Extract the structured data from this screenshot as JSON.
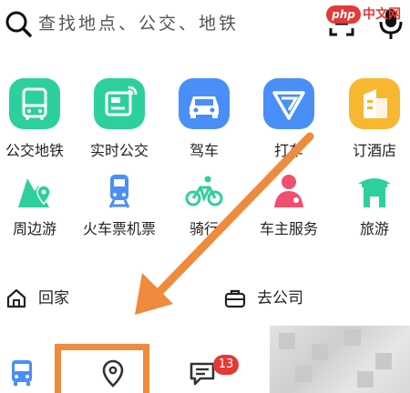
{
  "search": {
    "placeholder": "查找地点、公交、地铁"
  },
  "watermark": {
    "logo": "php",
    "text": "中文网"
  },
  "services_row1": [
    {
      "id": "transit",
      "label": "公交地铁",
      "icon": "bus-icon",
      "color": "#2ecf9e"
    },
    {
      "id": "realtime-bus",
      "label": "实时公交",
      "icon": "realtime-bus-icon",
      "color": "#2ecf9e"
    },
    {
      "id": "drive",
      "label": "驾车",
      "icon": "car-icon",
      "color": "#4a8ff7"
    },
    {
      "id": "taxi",
      "label": "打车",
      "icon": "taxi-icon",
      "color": "#4a8ff7"
    },
    {
      "id": "hotel",
      "label": "订酒店",
      "icon": "hotel-icon",
      "color": "#f7b731"
    }
  ],
  "services_row2": [
    {
      "id": "nearby-tour",
      "label": "周边游",
      "icon": "map-pin-icon",
      "color": "#2ecf9e"
    },
    {
      "id": "train-plane",
      "label": "火车票机票",
      "icon": "train-icon",
      "color": "#4a8ff7"
    },
    {
      "id": "cycling",
      "label": "骑行",
      "icon": "bicycle-icon",
      "color": "#2ecf9e"
    },
    {
      "id": "car-owner",
      "label": "车主服务",
      "icon": "person-icon",
      "color": "#f0506e"
    },
    {
      "id": "travel",
      "label": "旅游",
      "icon": "temple-icon",
      "color": "#2ecf9e"
    }
  ],
  "shortcuts": [
    {
      "id": "home",
      "label": "回家",
      "icon": "home-icon"
    },
    {
      "id": "company",
      "label": "去公司",
      "icon": "briefcase-icon"
    }
  ],
  "tabbar": {
    "tabs": [
      {
        "id": "bus",
        "icon": "bus-tab-icon"
      },
      {
        "id": "location",
        "icon": "location-pin-icon"
      },
      {
        "id": "messages",
        "icon": "message-icon"
      }
    ],
    "message_badge": "13"
  },
  "colors": {
    "accent": "#4a8ff7",
    "green": "#2ecf9e",
    "highlight": "#f08a3c",
    "badge": "#e53935"
  }
}
